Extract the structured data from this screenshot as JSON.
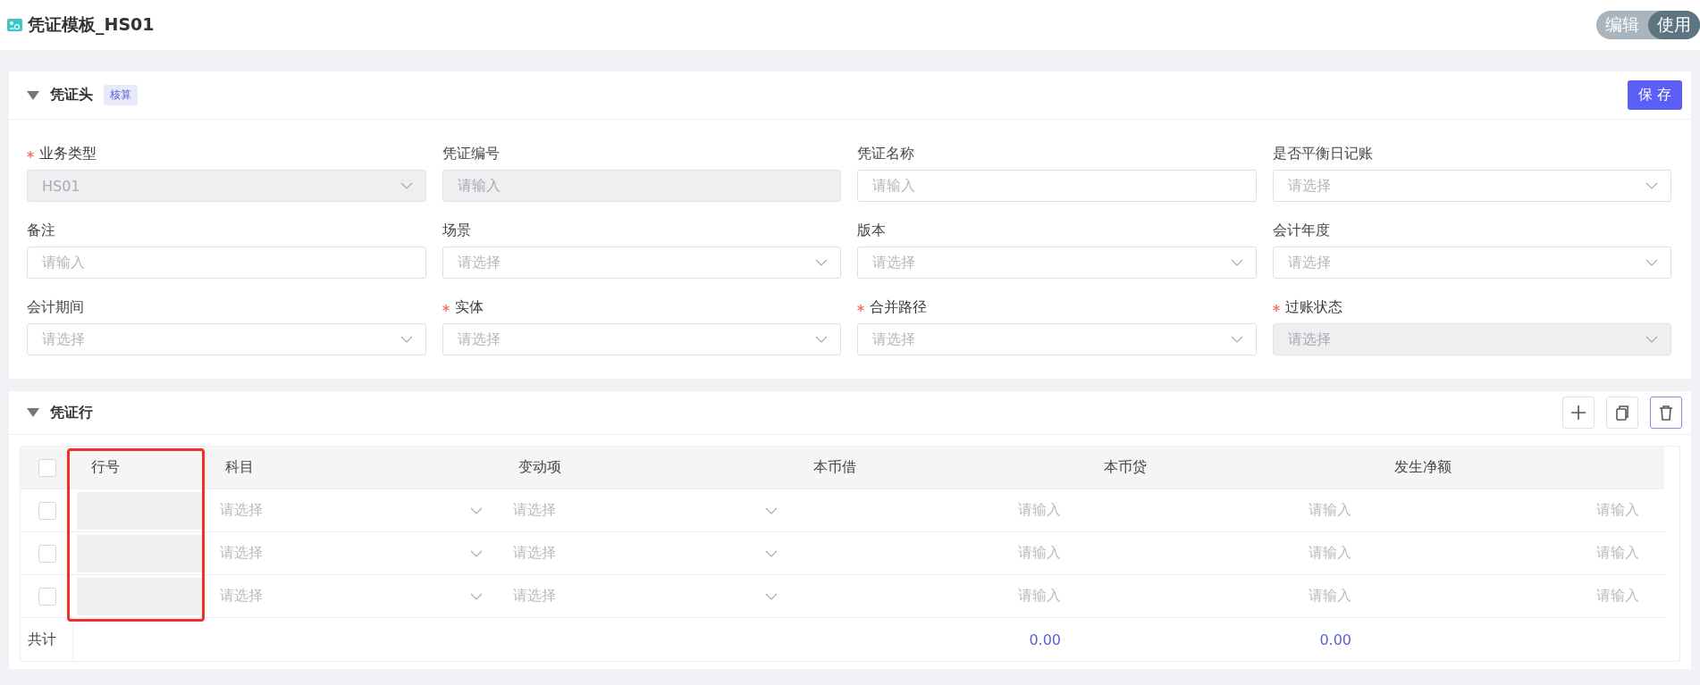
{
  "page": {
    "title": "凭证模板_HS01",
    "mode_toggle": [
      {
        "label": "编辑",
        "selected": false
      },
      {
        "label": "使用",
        "selected": true
      }
    ]
  },
  "header_section": {
    "title": "凭证头",
    "expanded": true,
    "badge": "核算",
    "save_button": "保 存",
    "fields": [
      {
        "label": "业务类型",
        "required": true,
        "kind": "select",
        "value": "HS01",
        "disabled": true
      },
      {
        "label": "凭证编号",
        "required": false,
        "kind": "input",
        "placeholder": "请输入",
        "disabled": true
      },
      {
        "label": "凭证名称",
        "required": false,
        "kind": "input",
        "placeholder": "请输入",
        "disabled": false
      },
      {
        "label": "是否平衡日记账",
        "required": false,
        "kind": "select",
        "placeholder": "请选择",
        "disabled": false
      },
      {
        "label": "备注",
        "required": false,
        "kind": "input",
        "placeholder": "请输入",
        "disabled": false
      },
      {
        "label": "场景",
        "required": false,
        "kind": "select",
        "placeholder": "请选择",
        "disabled": false
      },
      {
        "label": "版本",
        "required": false,
        "kind": "select",
        "placeholder": "请选择",
        "disabled": false
      },
      {
        "label": "会计年度",
        "required": false,
        "kind": "select",
        "placeholder": "请选择",
        "disabled": false
      },
      {
        "label": "会计期间",
        "required": false,
        "kind": "select",
        "placeholder": "请选择",
        "disabled": false
      },
      {
        "label": "实体",
        "required": true,
        "kind": "select",
        "placeholder": "请选择",
        "disabled": false
      },
      {
        "label": "合并路径",
        "required": true,
        "kind": "select",
        "placeholder": "请选择",
        "disabled": false
      },
      {
        "label": "过账状态",
        "required": true,
        "kind": "select",
        "placeholder": "请选择",
        "disabled": true
      }
    ]
  },
  "lines_section": {
    "title": "凭证行",
    "expanded": true,
    "toolbar": [
      {
        "kind": "add",
        "focused": false
      },
      {
        "kind": "copy",
        "focused": false
      },
      {
        "kind": "delete",
        "focused": true
      }
    ],
    "table": {
      "select_all_checked": false,
      "columns": [
        {
          "label": "行号",
          "highlighted": true
        },
        {
          "label": "科目",
          "highlighted": false
        },
        {
          "label": "变动项",
          "highlighted": false
        },
        {
          "label": "本币借",
          "highlighted": false
        },
        {
          "label": "本币贷",
          "highlighted": false
        },
        {
          "label": "发生净额",
          "highlighted": false
        }
      ],
      "rows": [
        {
          "checked": false,
          "account": "请选择",
          "change_item": "请选择",
          "debit": "请输入",
          "credit": "请输入",
          "net": "请输入"
        },
        {
          "checked": false,
          "account": "请选择",
          "change_item": "请选择",
          "debit": "请输入",
          "credit": "请输入",
          "net": "请输入"
        },
        {
          "checked": false,
          "account": "请选择",
          "change_item": "请选择",
          "debit": "请输入",
          "credit": "请输入",
          "net": "请输入"
        }
      ],
      "footer": {
        "label": "共计",
        "debit_total": "0.00",
        "credit_total": "0.00"
      }
    }
  }
}
